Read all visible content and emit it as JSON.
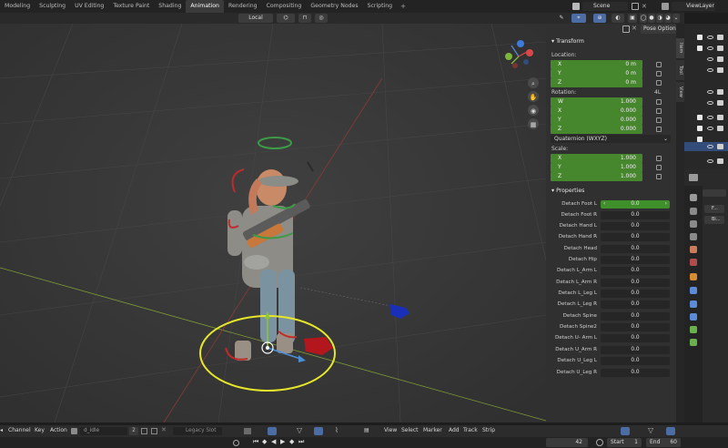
{
  "workspaces": [
    "Modeling",
    "Sculpting",
    "UV Editing",
    "Texture Paint",
    "Shading",
    "Animation",
    "Rendering",
    "Compositing",
    "Geometry Nodes",
    "Scripting"
  ],
  "add_tab": "+",
  "scene": "Scene",
  "view_layer": "ViewLayer",
  "viewport_header": {
    "orientation": "Local"
  },
  "pose_options": "Pose Options",
  "sidebar_tabs": [
    "Item",
    "Tool",
    "View"
  ],
  "transform": {
    "title": "Transform",
    "location_label": "Location:",
    "location": [
      {
        "axis": "X",
        "value": "0 m"
      },
      {
        "axis": "Y",
        "value": "0 m"
      },
      {
        "axis": "Z",
        "value": "0 m"
      }
    ],
    "rotation_label": "Rotation:",
    "rotation_mode_badge": "4L",
    "rotation": [
      {
        "axis": "W",
        "value": "1.000"
      },
      {
        "axis": "X",
        "value": "0.000"
      },
      {
        "axis": "Y",
        "value": "0.000"
      },
      {
        "axis": "Z",
        "value": "0.000"
      }
    ],
    "rotation_mode": "Quaternion (WXYZ)",
    "scale_label": "Scale:",
    "scale": [
      {
        "axis": "X",
        "value": "1.000"
      },
      {
        "axis": "Y",
        "value": "1.000"
      },
      {
        "axis": "Z",
        "value": "1.000"
      }
    ]
  },
  "properties": {
    "title": "Properties",
    "items": [
      {
        "label": "Detach Foot L",
        "value": "0.0"
      },
      {
        "label": "Detach Foot R",
        "value": "0.0"
      },
      {
        "label": "Detach Hand L",
        "value": "0.0"
      },
      {
        "label": "Detach Hand R",
        "value": "0.0"
      },
      {
        "label": "Detach Head",
        "value": "0.0"
      },
      {
        "label": "Detach Hip",
        "value": "0.0"
      },
      {
        "label": "Detach L_Arm L",
        "value": "0.0"
      },
      {
        "label": "Detach L_Arm R",
        "value": "0.0"
      },
      {
        "label": "Detach L_Leg L",
        "value": "0.0"
      },
      {
        "label": "Detach L_Leg R",
        "value": "0.0"
      },
      {
        "label": "Detach Spine",
        "value": "0.0"
      },
      {
        "label": "Detach Spine2",
        "value": "0.0"
      },
      {
        "label": "Detach U- Arm L",
        "value": "0.0"
      },
      {
        "label": "Detach U_Arm R",
        "value": "0.0"
      },
      {
        "label": "Detach U_Leg L",
        "value": "0.0"
      },
      {
        "label": "Detach U_Leg R",
        "value": "0.0"
      }
    ]
  },
  "timeline": {
    "menus": [
      "Channel",
      "Key",
      "Action"
    ],
    "action_name": "d_idle",
    "action_users": "2",
    "legacy_slot": "Legacy Slot",
    "menus_right": [
      "View",
      "Select",
      "Marker",
      "Add",
      "Track",
      "Strip"
    ]
  },
  "playback": {
    "current_frame": "42",
    "start_label": "Start",
    "start": "1",
    "end_label": "End",
    "end": "60"
  },
  "properties_editor_tabs": [
    "F...",
    "Bi..."
  ],
  "colors": {
    "accent_green": "#46862c",
    "active_tab": "#3b3b3b",
    "ring": "#e6e62a"
  }
}
